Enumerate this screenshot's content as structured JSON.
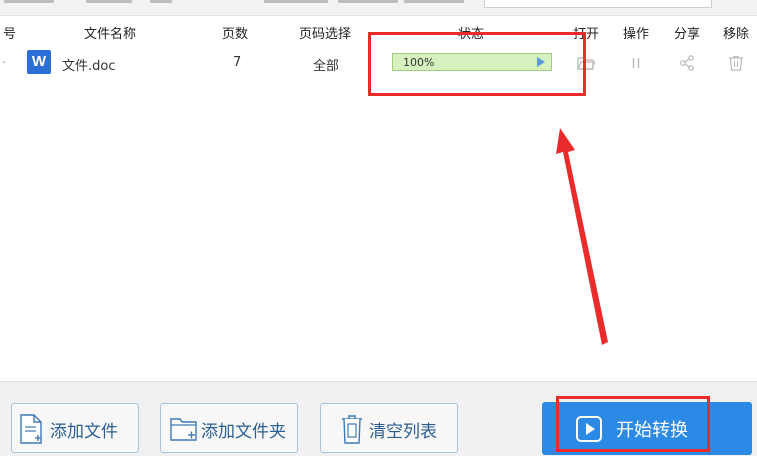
{
  "table": {
    "headers": {
      "index": "号",
      "filename": "文件名称",
      "pages": "页数",
      "page_select": "页码选择",
      "status": "状态",
      "open": "打开",
      "action": "操作",
      "share": "分享",
      "remove": "移除"
    },
    "rows": [
      {
        "icon": "W",
        "filename": "文件.doc",
        "pages": "7",
        "page_select": "全部",
        "progress_label": "100%",
        "progress": 100
      }
    ]
  },
  "bottom": {
    "add_file": "添加文件",
    "add_folder": "添加文件夹",
    "clear_list": "清空列表",
    "start": "开始转换"
  },
  "colors": {
    "accent": "#2b8ae6",
    "progress_fill": "#d7f0bf",
    "annotation": "#ea2b2b",
    "word_icon": "#2b6fd6"
  }
}
